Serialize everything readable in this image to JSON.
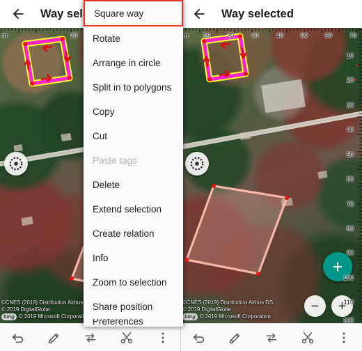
{
  "app": {
    "title": "Way selected",
    "back_icon": "back-arrow-icon"
  },
  "panels": [
    {
      "id": "left",
      "title": "Way selected"
    },
    {
      "id": "right",
      "title": "Way selected"
    }
  ],
  "menu": {
    "items": [
      {
        "label": "Square way",
        "state": "highlighted"
      },
      {
        "label": "Rotate",
        "state": "normal"
      },
      {
        "label": "Arrange in circle",
        "state": "normal"
      },
      {
        "label": "Split in to polygons",
        "state": "normal"
      },
      {
        "label": "Copy",
        "state": "normal"
      },
      {
        "label": "Cut",
        "state": "normal"
      },
      {
        "label": "Paste tags",
        "state": "disabled"
      },
      {
        "label": "Delete",
        "state": "normal"
      },
      {
        "label": "Extend selection",
        "state": "normal"
      },
      {
        "label": "Create relation",
        "state": "normal"
      },
      {
        "label": "Info",
        "state": "normal"
      },
      {
        "label": "Zoom to selection",
        "state": "normal"
      },
      {
        "label": "Share position",
        "state": "normal"
      },
      {
        "label": "Preferences",
        "state": "partial"
      }
    ],
    "highlight_color": "#e8342a"
  },
  "toolbar": {
    "items": [
      {
        "name": "undo-icon",
        "label": "Undo"
      },
      {
        "name": "edit-icon",
        "label": "Edit properties"
      },
      {
        "name": "transfer-icon",
        "label": "Transfer"
      },
      {
        "name": "cut-icon",
        "label": "Cut"
      },
      {
        "name": "overflow-icon",
        "label": "More options"
      }
    ]
  },
  "map": {
    "ruler_unit": "m",
    "ruler_h_ticks": [
      "10",
      "20",
      "30",
      "40",
      "50",
      "60",
      "70"
    ],
    "ruler_v_ticks": [
      "10",
      "20",
      "30",
      "40",
      "50",
      "60",
      "70",
      "80",
      "90",
      "100",
      "110",
      "120"
    ],
    "attribution": {
      "line1": "©CNES (2019) Distribution Airbus DS",
      "line2": "© 2019 DigitalGlobe",
      "provider_logo": "bing",
      "line3": "© 2019 Microsoft Corporation"
    },
    "controls": {
      "gps_icon": "gps-target-icon",
      "add_label": "+",
      "zoom_out_label": "−",
      "zoom_in_label": "+"
    },
    "colors": {
      "selected_way_fill": "#ff20d0",
      "selected_way_halo": "#ffff30",
      "way_outline": "#f6b6a8",
      "vertex": "#ee1111",
      "direction_arrow": "#d81111",
      "fab_accent": "#009688"
    }
  }
}
